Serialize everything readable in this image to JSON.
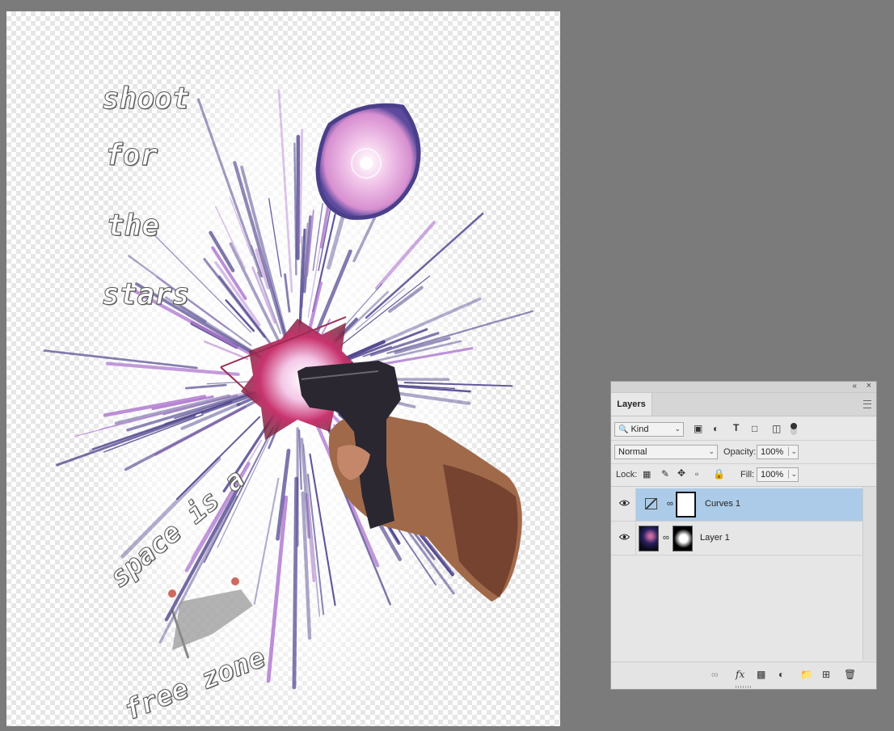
{
  "canvas": {
    "poster_lines": [
      "shoot",
      "for",
      "the",
      "stars"
    ],
    "bottom_phrase_1": "space is a",
    "bottom_phrase_2": "free zone"
  },
  "layers_panel": {
    "tab_label": "Layers",
    "filter": {
      "kind_label": "Kind"
    },
    "blend_mode": "Normal",
    "opacity_label": "Opacity:",
    "opacity_value": "100%",
    "lock_label": "Lock:",
    "fill_label": "Fill:",
    "fill_value": "100%",
    "layers": [
      {
        "name": "Curves 1",
        "selected": true
      },
      {
        "name": "Layer 1",
        "selected": false
      }
    ],
    "footer_icons": [
      "link-icon",
      "fx-icon",
      "mask-icon",
      "adjustment-icon",
      "folder-icon",
      "new-layer-icon",
      "trash-icon"
    ]
  },
  "colors": {
    "workspace_bg": "#7b7b7b",
    "selection": "#abcbe8",
    "burst_purple": "#4b3f8a",
    "nebula_pink": "#e6b4dc"
  }
}
